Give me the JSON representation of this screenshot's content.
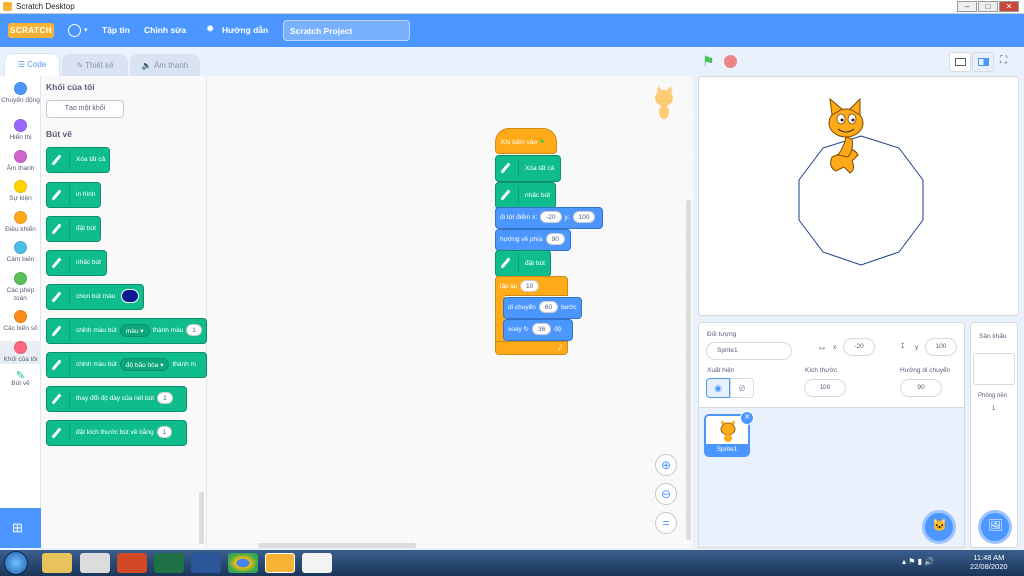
{
  "window": {
    "title": "Scratch Desktop",
    "minimize": "–",
    "maximize": "□",
    "close": "✕"
  },
  "menubar": {
    "logo": "SCRATCH",
    "items": [
      "Tập tin",
      "Chỉnh sửa",
      "Hướng dẫn"
    ],
    "project_title": "Scratch Project"
  },
  "tabs": [
    {
      "label": "Code",
      "icon": "code-icon",
      "active": true
    },
    {
      "label": "Thiết kế",
      "icon": "brush-icon",
      "active": false
    },
    {
      "label": "Âm thanh",
      "icon": "speaker-icon",
      "active": false
    }
  ],
  "categories": [
    {
      "label": "Chuyển động",
      "color": "#4c97ff"
    },
    {
      "label": "Hiển thị",
      "color": "#9966ff"
    },
    {
      "label": "Âm thanh",
      "color": "#cf63cf"
    },
    {
      "label": "Sự kiện",
      "color": "#ffd500"
    },
    {
      "label": "Điều khiển",
      "color": "#ffab19"
    },
    {
      "label": "Cảm biến",
      "color": "#4cbfe6"
    },
    {
      "label": "Các phép toán",
      "color": "#59c059"
    },
    {
      "label": "Các biến số",
      "color": "#ff8c1a"
    },
    {
      "label": "Khối của tôi",
      "color": "#ff6680"
    },
    {
      "label": "Bút vẽ",
      "color": "#0fbd8c"
    }
  ],
  "palette": {
    "my_blocks_header": "Khối của tôi",
    "make_block": "Tạo một khối",
    "pen_header": "Bút vẽ",
    "blocks": [
      {
        "text": "Xóa tất cả"
      },
      {
        "text": "in hình"
      },
      {
        "text": "đặt bút"
      },
      {
        "text": "nhấc bút"
      },
      {
        "text": "chọn bút màu"
      },
      {
        "text": "chỉnh màu bút",
        "dropdown": "màu",
        "text2": "thành màu",
        "value": "1"
      },
      {
        "text": "chỉnh màu bút",
        "dropdown": "độ bão hòa",
        "text2": "thành m"
      },
      {
        "text": "thay đổi độ dày của nét bút",
        "value": "1"
      },
      {
        "text": "đặt kích thước bút vẽ bằng",
        "value": "1"
      }
    ],
    "pen_color": "#0b1a8c"
  },
  "script": {
    "hat": "Khi bấm vào",
    "b1": "Xóa tất cả",
    "b2": "nhấc bút",
    "goto": "đi tới điểm x:",
    "goto_x": "-20",
    "goto_y_label": "y:",
    "goto_y": "100",
    "point": "hướng về phía",
    "point_val": "90",
    "pendown": "đặt bút",
    "repeat": "lặp lại",
    "repeat_val": "10",
    "move": "di chuyển",
    "move_val": "60",
    "move_unit": "bước",
    "turn": "xoay",
    "turn_val": "36",
    "turn_unit": "độ"
  },
  "sprite_info": {
    "object_label": "Đối tượng",
    "name": "Sprite1",
    "x_label": "x",
    "x": "-20",
    "y_label": "y",
    "y": "100",
    "show_label": "Xuất hiện",
    "size_label": "Kích thước",
    "size": "100",
    "direction_label": "Hướng di chuyển",
    "direction": "90"
  },
  "sprite_list": [
    {
      "name": "Sprite1",
      "selected": true
    }
  ],
  "backdrop": {
    "title": "Sân khấu",
    "label": "Phông nền",
    "count": "1"
  },
  "taskbar": {
    "time": "11:48 AM",
    "date": "22/08/2020"
  },
  "colors": {
    "accent": "#4c97ff",
    "pen": "#0fbd8c",
    "control": "#ffab19"
  }
}
